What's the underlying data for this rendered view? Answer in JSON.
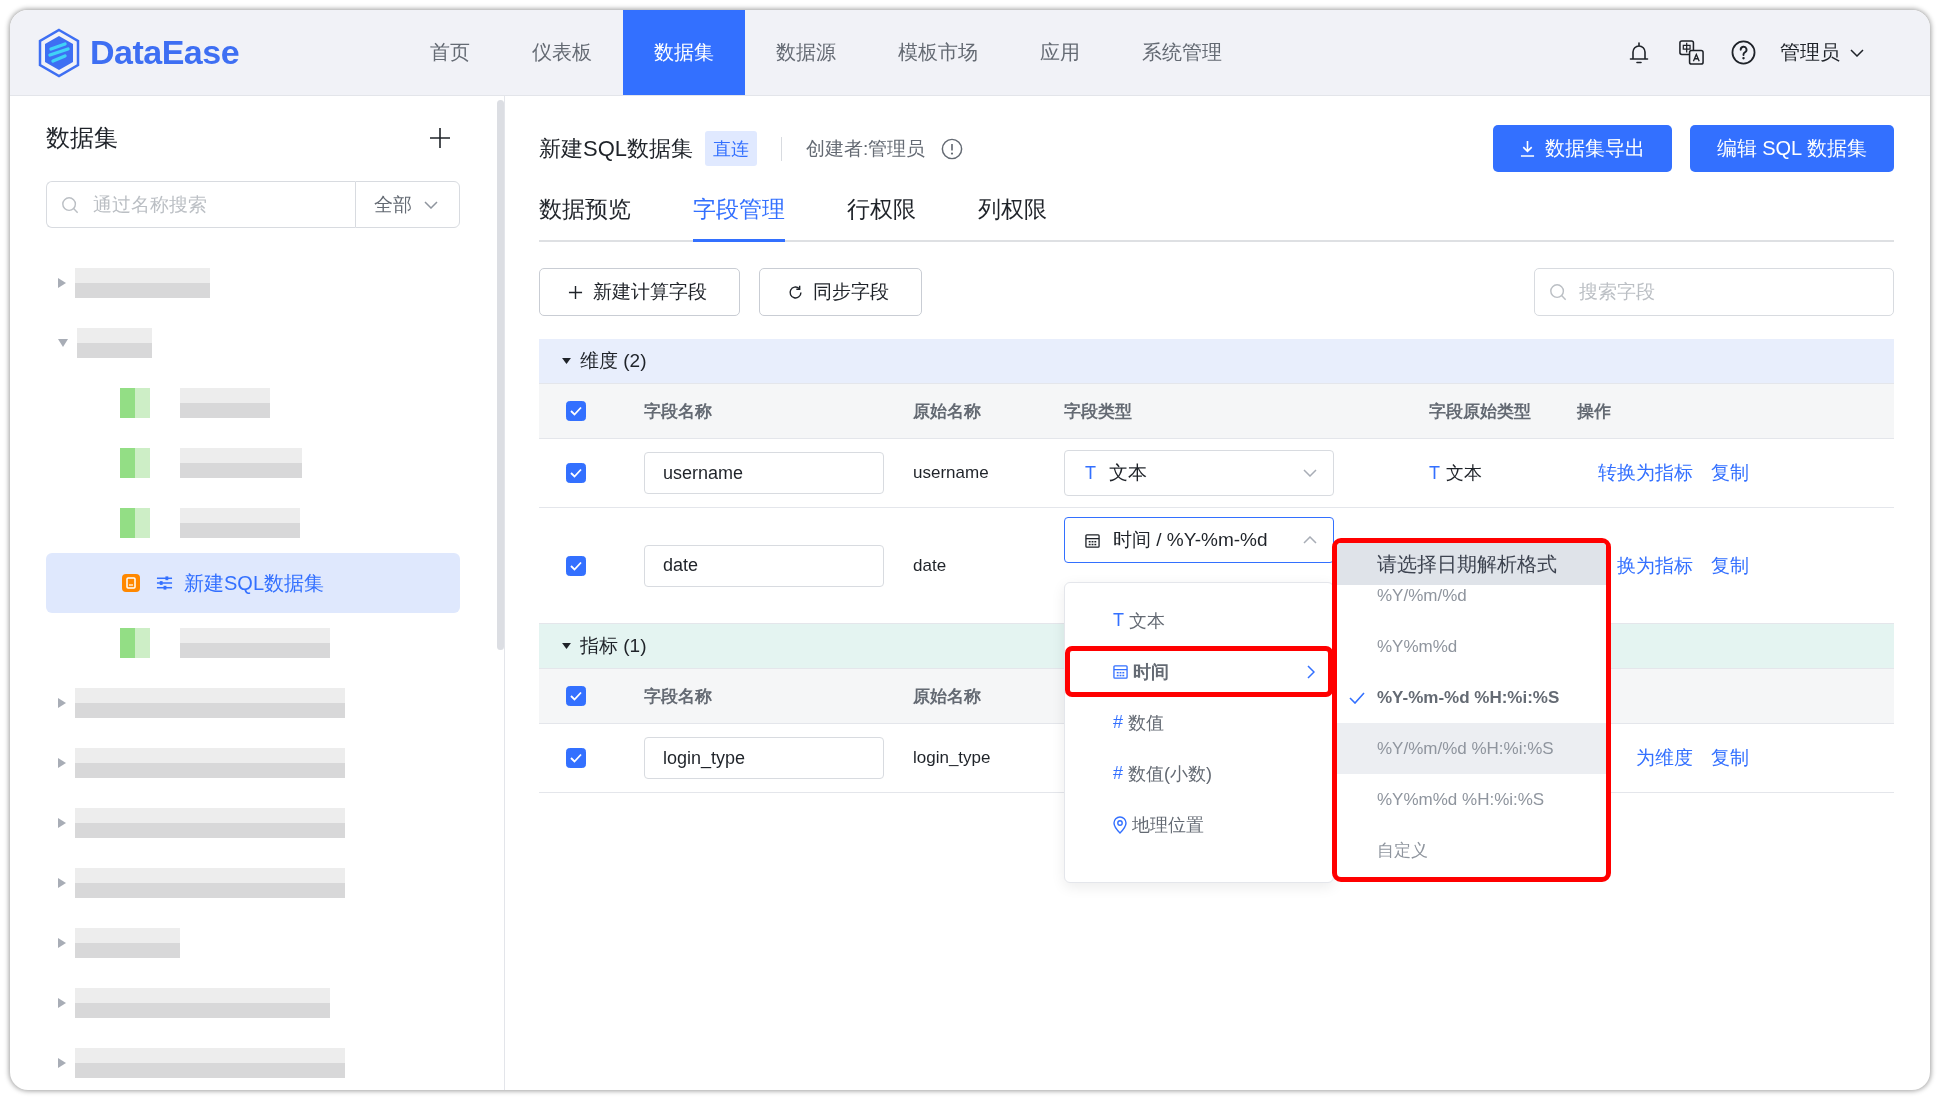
{
  "header": {
    "logo": "DataEase",
    "nav": [
      {
        "label": "首页",
        "selected": false
      },
      {
        "label": "仪表板",
        "selected": false
      },
      {
        "label": "数据集",
        "selected": true
      },
      {
        "label": "数据源",
        "selected": false
      },
      {
        "label": "模板市场",
        "selected": false
      },
      {
        "label": "应用",
        "selected": false
      },
      {
        "label": "系统管理",
        "selected": false
      }
    ],
    "user": "管理员"
  },
  "sidebar": {
    "title": "数据集",
    "search": {
      "placeholder": "通过名称搜索"
    },
    "filter": "全部",
    "tree": [
      {
        "kind": "folder",
        "expanded": false,
        "selected": false
      },
      {
        "kind": "folder",
        "expanded": true,
        "selected": false,
        "children": [
          {
            "kind": "dataset",
            "selected": false
          },
          {
            "kind": "dataset",
            "selected": false
          },
          {
            "kind": "dataset",
            "selected": false
          },
          {
            "kind": "sql_dataset",
            "label": "新建SQL数据集",
            "selected": true
          },
          {
            "kind": "dataset",
            "selected": false
          }
        ]
      },
      {
        "kind": "folder",
        "expanded": false,
        "selected": false
      },
      {
        "kind": "folder",
        "expanded": false,
        "selected": false
      },
      {
        "kind": "folder",
        "expanded": false,
        "selected": false
      },
      {
        "kind": "folder",
        "expanded": false,
        "selected": false
      },
      {
        "kind": "folder",
        "expanded": false,
        "selected": false
      },
      {
        "kind": "folder",
        "expanded": false,
        "selected": false
      },
      {
        "kind": "folder",
        "expanded": false,
        "selected": false
      }
    ]
  },
  "dataset": {
    "title": "新建SQL数据集",
    "tag": "直连",
    "creator": "创建者:管理员",
    "buttons": [
      {
        "kind": "export",
        "label": "数据集导出"
      },
      {
        "kind": "edit",
        "label": "编辑 SQL 数据集"
      }
    ]
  },
  "tabs": [
    {
      "label": "数据预览",
      "selected": false
    },
    {
      "label": "字段管理",
      "selected": true
    },
    {
      "label": "行权限",
      "selected": false
    },
    {
      "label": "列权限",
      "selected": false
    }
  ],
  "toolbar": {
    "buttons": [
      {
        "kind": "add",
        "label": "新建计算字段"
      },
      {
        "kind": "sync",
        "label": "同步字段"
      }
    ],
    "search": {
      "placeholder": "搜索字段"
    }
  },
  "sections": [
    {
      "kind": "dimension",
      "title": "维度 (2)",
      "expanded": true,
      "all_checked": true,
      "columns": [
        "字段名称",
        "原始名称",
        "字段类型",
        "字段原始类型",
        "操作"
      ],
      "rows": [
        {
          "checked": true,
          "name": "username",
          "origin": "username",
          "type": {
            "kind": "text",
            "glyph": "T",
            "label": "文本",
            "open": false
          },
          "origin_type": {
            "glyph": "T",
            "label": "文本"
          },
          "actions": [
            "转换为指标",
            "复制"
          ]
        },
        {
          "checked": true,
          "name": "date",
          "origin": "date",
          "type": {
            "kind": "time",
            "label": "时间 / %Y-%m-%d",
            "open": true
          },
          "actions": [
            "换为指标",
            "复制"
          ]
        }
      ]
    },
    {
      "kind": "measure",
      "title": "指标 (1)",
      "expanded": true,
      "all_checked": true,
      "columns": [
        "字段名称",
        "原始名称"
      ],
      "rows": [
        {
          "checked": true,
          "name": "login_type",
          "origin": "login_type",
          "actions": [
            "为维度",
            "复制"
          ]
        }
      ]
    }
  ],
  "type_menu": {
    "items": [
      {
        "kind": "text",
        "glyph": "T",
        "label": "文本",
        "selected": false,
        "expandable": false,
        "annotated": false
      },
      {
        "kind": "time",
        "label": "时间",
        "selected": true,
        "expandable": true,
        "annotated": true
      },
      {
        "kind": "number",
        "glyph": "#",
        "label": "数值",
        "selected": false,
        "expandable": false,
        "annotated": false
      },
      {
        "kind": "number",
        "glyph": "#",
        "label": "数值(小数)",
        "selected": false,
        "expandable": false,
        "annotated": false
      },
      {
        "kind": "location",
        "label": "地理位置",
        "selected": false,
        "expandable": false,
        "annotated": false
      }
    ],
    "submenu": {
      "title": "请选择日期解析格式",
      "annotated": true,
      "items": [
        {
          "label": "%Y/%m/%d",
          "selected": false,
          "hovered": false
        },
        {
          "label": "%Y%m%d",
          "selected": false,
          "hovered": false
        },
        {
          "label": "%Y-%m-%d %H:%i:%S",
          "selected": true,
          "hovered": false
        },
        {
          "label": "%Y/%m/%d %H:%i:%S",
          "selected": false,
          "hovered": true
        },
        {
          "label": "%Y%m%d %H:%i:%S",
          "selected": false,
          "hovered": false
        },
        {
          "label": "自定义",
          "selected": false,
          "hovered": false
        }
      ]
    }
  }
}
